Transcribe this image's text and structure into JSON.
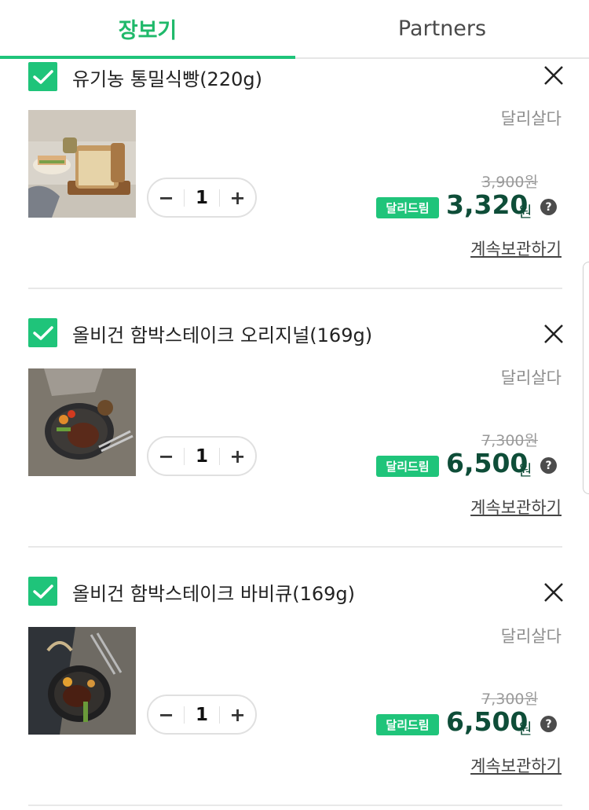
{
  "tabs": {
    "shopping": "장보기",
    "partners": "Partners"
  },
  "items": [
    {
      "name": "유기농 통밀식빵(220g)",
      "seller": "달리살다",
      "quantity": "1",
      "original_price": "3,900원",
      "badge": "달리드림",
      "price": "3,320",
      "currency": "원",
      "keep_label": "계속보관하기",
      "help": "?"
    },
    {
      "name": "올비건 함박스테이크 오리지널(169g)",
      "seller": "달리살다",
      "quantity": "1",
      "original_price": "7,300원",
      "badge": "달리드림",
      "price": "6,500",
      "currency": "원",
      "keep_label": "계속보관하기",
      "help": "?"
    },
    {
      "name": "올비건 함박스테이크 바비큐(169g)",
      "seller": "달리살다",
      "quantity": "1",
      "original_price": "7,300원",
      "badge": "달리드림",
      "price": "6,500",
      "currency": "원",
      "keep_label": "계속보관하기",
      "help": "?"
    }
  ],
  "colors": {
    "accent": "#1fc47a",
    "price": "#0e4d38"
  }
}
